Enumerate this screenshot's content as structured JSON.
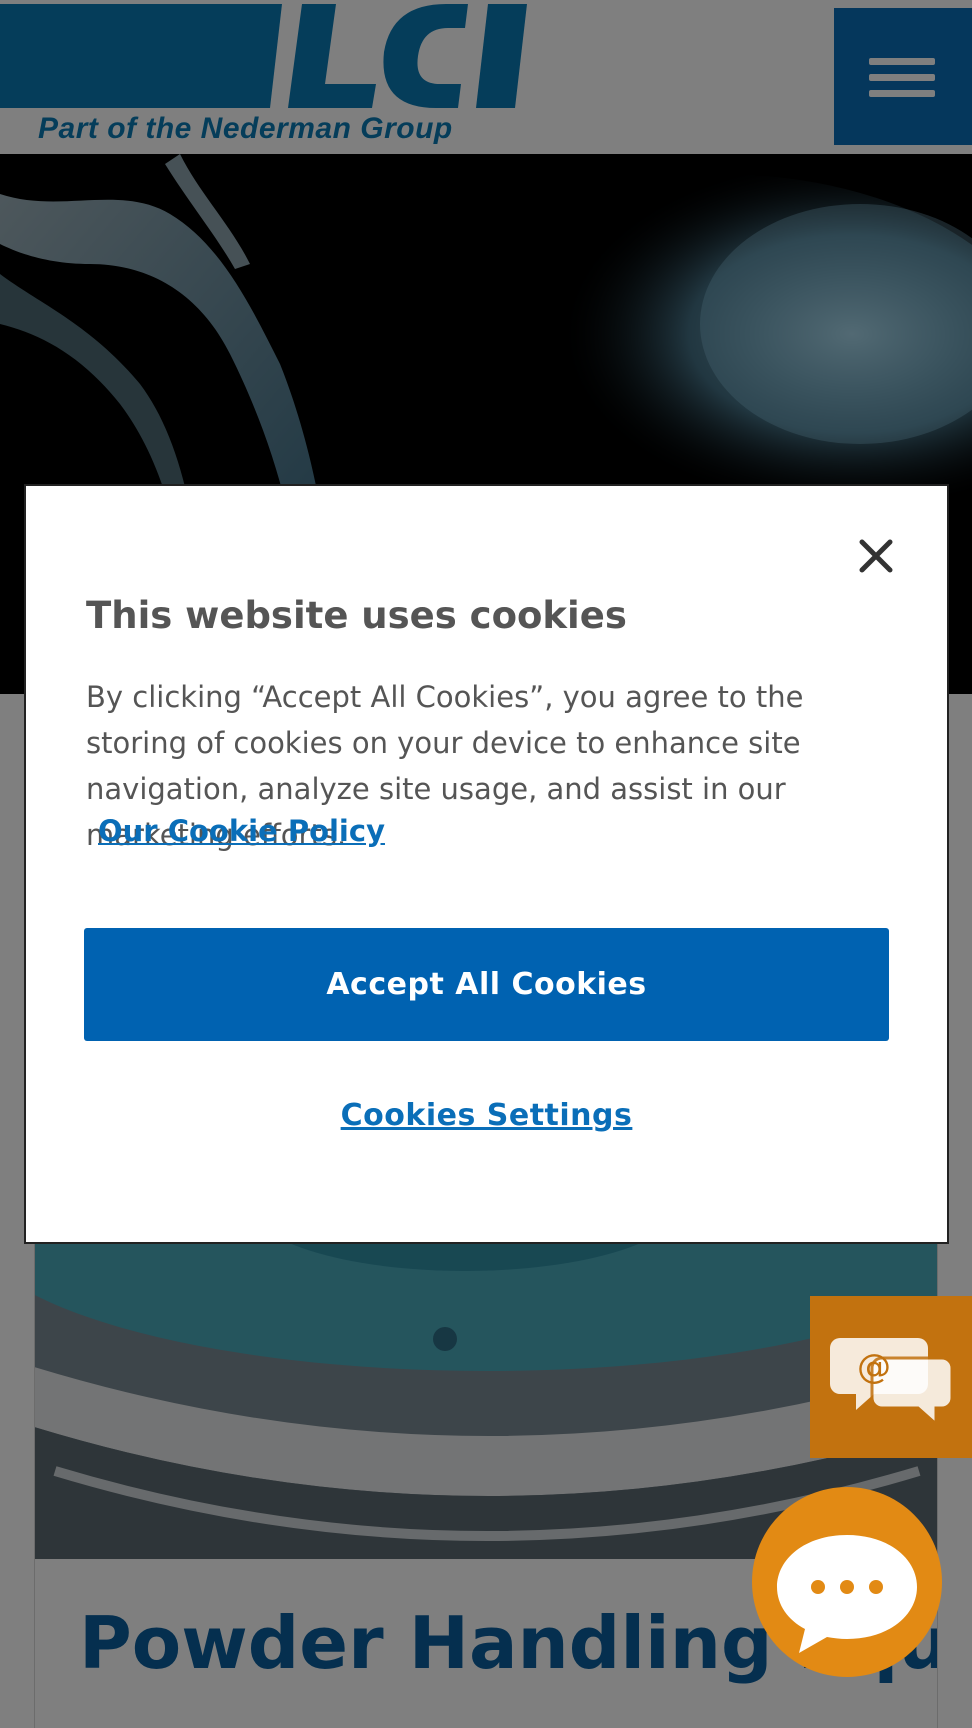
{
  "header": {
    "logo_text": "LCI",
    "logo_tagline": "Part of the Nederman Group",
    "menu_icon": "hamburger-menu-icon"
  },
  "product_card": {
    "title": "Powder Handling Equipment"
  },
  "floating": {
    "email_icon": "email-chat-icon",
    "chat_icon": "chat-bubble-icon"
  },
  "cookie_dialog": {
    "title": "This website uses cookies",
    "body": "By clicking “Accept All Cookies”, you agree to the storing of cookies on your device to enhance site navigation, analyze site usage, and assist in our marketing efforts.",
    "policy_link": "Our Cookie Policy",
    "accept_button": "Accept All Cookies",
    "settings_link": "Cookies Settings",
    "close_icon": "close-icon"
  },
  "colors": {
    "brand_blue": "#0a6eb8",
    "accept_blue": "#0062b1",
    "contact_orange": "#e28a14",
    "text_gray": "#555555"
  }
}
